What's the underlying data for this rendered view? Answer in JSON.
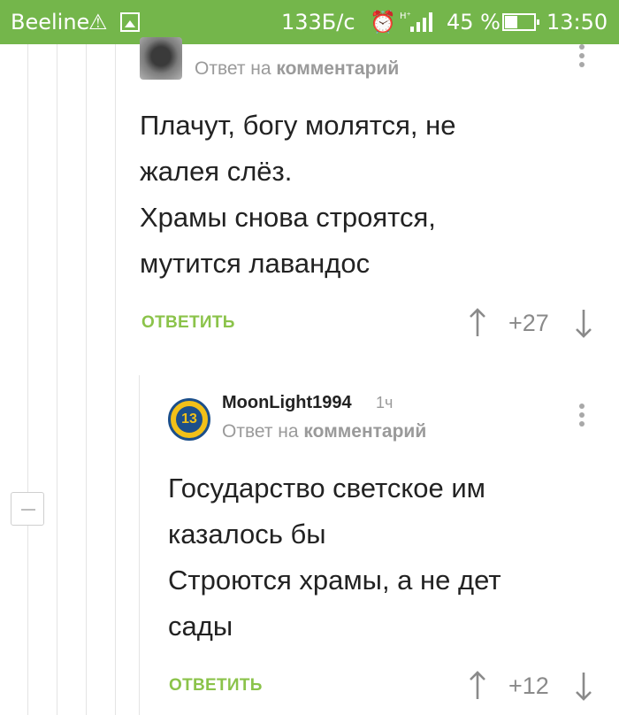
{
  "status_bar": {
    "carrier": "Beeline",
    "speed": "133Б/с",
    "network": "H⁺",
    "battery": "45 %",
    "time": "13:50",
    "background_color": "#74b64b"
  },
  "comments": [
    {
      "author": "",
      "reply_prefix": "Ответ на ",
      "reply_link": "комментарий",
      "body_lines": [
        "Плачут, богу молятся, не",
        "жалея слёз.",
        "Храмы снова строятся,",
        "мутится лавандос"
      ],
      "reply_label": "ОТВЕТИТЬ",
      "rating": "+27"
    },
    {
      "author": "MoonLight1994",
      "time": "1ч",
      "avatar_text": "13",
      "reply_prefix": "Ответ на ",
      "reply_link": "комментарий",
      "body_lines": [
        "Государство светское им",
        "казалось бы",
        "Строются храмы, а не дет",
        "сады"
      ],
      "reply_label": "ОТВЕТИТЬ",
      "rating": "+12"
    }
  ],
  "colors": {
    "accent": "#8bc34a",
    "muted": "#9a9a9a",
    "text": "#222222"
  }
}
